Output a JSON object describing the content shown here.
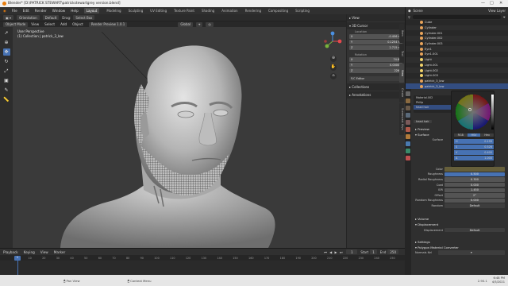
{
  "window": {
    "title": "Blender* [D:\\PATRICK STEWART\\patrickstewartgrey version.blend]",
    "controls": [
      "—",
      "□",
      "✕"
    ]
  },
  "menu": [
    "File",
    "Edit",
    "Render",
    "Window",
    "Help"
  ],
  "workspaces": [
    "Layout",
    "Modeling",
    "Sculpting",
    "UV Editing",
    "Texture Paint",
    "Shading",
    "Animation",
    "Rendering",
    "Compositing",
    "Scripting"
  ],
  "workspace_active": "Layout",
  "top_header": {
    "mode_chip": "Orientation",
    "default_chip": "Default",
    "drag_label": "Drag:",
    "select_box": "Select Box",
    "scene_label": "Scene",
    "view_layer": "View Layer",
    "options": "Options"
  },
  "vp_header": {
    "mode": "Object Mode",
    "menus": [
      "View",
      "Select",
      "Add",
      "Object"
    ],
    "global": "Global",
    "render_preview": "Render Preview 1.0.1"
  },
  "viewport": {
    "perspective": "User Perspective",
    "collection": "(1) Collection | patrick_3_low"
  },
  "npanel": {
    "view_section": "View",
    "cursor_section": "3D Cursor",
    "location_label": "Location",
    "location": [
      {
        "axis": "X",
        "value": "-0.456 m"
      },
      {
        "axis": "Y",
        "value": "0.1254 m"
      },
      {
        "axis": "Z",
        "value": "2.715 m"
      }
    ],
    "rotation_label": "Rotation",
    "rotation": [
      {
        "axis": "X",
        "value": "74.8°"
      },
      {
        "axis": "Y",
        "value": "0.0000°"
      },
      {
        "axis": "Z",
        "value": "226°"
      }
    ],
    "fit_label": "F/C Editor",
    "collections": "Collections",
    "annotations": "Annotations",
    "tabs": [
      "Item",
      "Tool",
      "View",
      "Create",
      "Screencast Keys"
    ]
  },
  "outliner": {
    "items": [
      {
        "label": "Cube",
        "color": "#e8a35a"
      },
      {
        "label": "Cylinder",
        "color": "#e8a35a"
      },
      {
        "label": "Cylinder.001",
        "color": "#e8a35a"
      },
      {
        "label": "Cylinder.002",
        "color": "#e8a35a"
      },
      {
        "label": "Cylinder.003",
        "color": "#e8a35a"
      },
      {
        "label": "Eye1",
        "color": "#e8a35a"
      },
      {
        "label": "Eye1.001",
        "color": "#e8a35a"
      },
      {
        "label": "Light",
        "color": "#f2d36b"
      },
      {
        "label": "Light.001",
        "color": "#f2d36b"
      },
      {
        "label": "Light.002",
        "color": "#f2d36b"
      },
      {
        "label": "Light.003",
        "color": "#f2d36b"
      },
      {
        "label": "patrick_3_low",
        "color": "#e8a35a"
      },
      {
        "label": "patrick_3_low",
        "color": "#e8a35a"
      }
    ]
  },
  "properties": {
    "materials": [
      "Material.002",
      "Philip",
      "head hair"
    ],
    "material_name": "head hair",
    "preview": "Preview",
    "surface_section": "Surface",
    "surface_label": "Surface",
    "rows": [
      {
        "label": "Color",
        "value": ""
      },
      {
        "label": "Roughness",
        "value": "0.500"
      },
      {
        "label": "Radial Roughness",
        "value": "0.300"
      },
      {
        "label": "Coat",
        "value": "0.000"
      },
      {
        "label": "IOR",
        "value": "1.450"
      },
      {
        "label": "Offset",
        "value": "2°"
      },
      {
        "label": "Random Roughness",
        "value": "0.000"
      },
      {
        "label": "Random",
        "value": "Default"
      }
    ],
    "volume": "Volume",
    "displacement_section": "Displacement",
    "displacement_label": "Displacement",
    "displacement_value": "Default",
    "settings": "Settings",
    "converter": "Polygon Material Converter",
    "normals_label": "Normals Kel"
  },
  "picker": {
    "modes": [
      "RGB",
      "HSV",
      "Hex"
    ],
    "mode_active": "HSV",
    "fields": [
      {
        "k": "H",
        "v": "0.199"
      },
      {
        "k": "S",
        "v": "0.526"
      },
      {
        "k": "V",
        "v": "0.400"
      },
      {
        "k": "A",
        "v": "1.000"
      }
    ]
  },
  "timeline": {
    "menus": [
      "Playback",
      "Keying",
      "View",
      "Marker"
    ],
    "current_frame": "1",
    "start_label": "Start",
    "start": "1",
    "end_label": "End",
    "end": "250",
    "ticks": [
      "0",
      "10",
      "20",
      "30",
      "40",
      "50",
      "60",
      "70",
      "80",
      "90",
      "100",
      "110",
      "120",
      "130",
      "140",
      "150",
      "160",
      "170",
      "180",
      "190",
      "200",
      "210",
      "220",
      "230",
      "240",
      "250"
    ]
  },
  "status": {
    "left": "Pan View",
    "mid": "Context Menu",
    "right": "2.90.1",
    "time": "6:48 PM",
    "date": "4/5/2021"
  }
}
